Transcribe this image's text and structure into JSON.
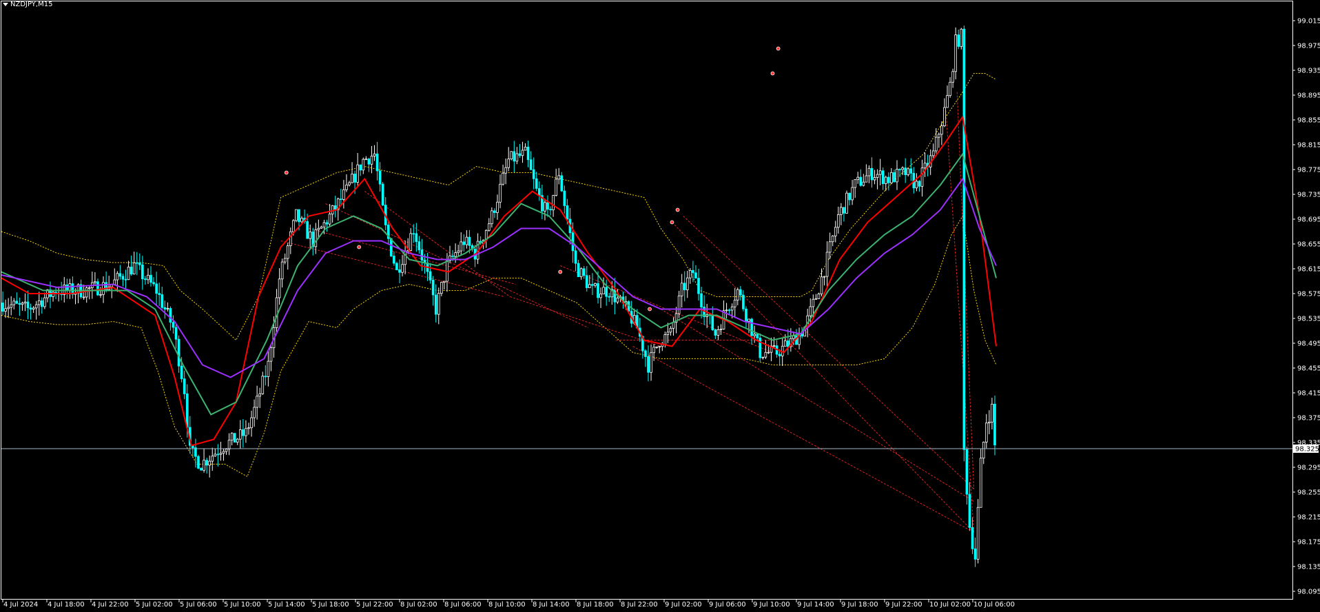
{
  "symbol": {
    "label": "NZDJPY,M15"
  },
  "colors": {
    "background": "#000000",
    "frame": "#ffffff",
    "candle_bull": "#ffffff",
    "candle_bear": "#00ffff",
    "ma_fast": "#ff0000",
    "ma_mid": "#3cb371",
    "ma_slow": "#9b30ff",
    "bands": "#ffd700",
    "fan_lines": "#ff2a2a",
    "price_line": "#a9b7c6"
  },
  "chart_data": {
    "type": "candlestick",
    "timeframe": "M15",
    "symbol": "NZDJPY",
    "ylim": [
      98.095,
      99.015
    ],
    "y_ticks": [
      "99.015",
      "98.975",
      "98.935",
      "98.895",
      "98.855",
      "98.815",
      "98.775",
      "98.735",
      "98.695",
      "98.655",
      "98.615",
      "98.575",
      "98.535",
      "98.495",
      "98.455",
      "98.415",
      "98.375",
      "98.335",
      "98.295",
      "98.255",
      "98.215",
      "98.175",
      "98.135",
      "98.095"
    ],
    "x_ticks": [
      "4 Jul 2024",
      "4 Jul 18:00",
      "4 Jul 22:00",
      "5 Jul 02:00",
      "5 Jul 06:00",
      "5 Jul 10:00",
      "5 Jul 14:00",
      "5 Jul 18:00",
      "5 Jul 22:00",
      "8 Jul 02:00",
      "8 Jul 06:00",
      "8 Jul 10:00",
      "8 Jul 14:00",
      "8 Jul 18:00",
      "8 Jul 22:00",
      "9 Jul 02:00",
      "9 Jul 06:00",
      "9 Jul 10:00",
      "9 Jul 14:00",
      "9 Jul 18:00",
      "9 Jul 22:00",
      "10 Jul 02:00",
      "10 Jul 06:00"
    ],
    "current_price": "98.325",
    "price_path": [
      [
        0,
        98.56
      ],
      [
        10,
        98.55
      ],
      [
        20,
        98.58
      ],
      [
        30,
        98.58
      ],
      [
        40,
        98.59
      ],
      [
        48,
        98.62
      ],
      [
        56,
        98.58
      ],
      [
        62,
        98.52
      ],
      [
        66,
        98.42
      ],
      [
        68,
        98.32
      ],
      [
        72,
        98.3
      ],
      [
        80,
        98.33
      ],
      [
        88,
        98.35
      ],
      [
        92,
        98.4
      ],
      [
        96,
        98.46
      ],
      [
        100,
        98.6
      ],
      [
        106,
        98.7
      ],
      [
        112,
        98.66
      ],
      [
        118,
        98.7
      ],
      [
        124,
        98.74
      ],
      [
        130,
        98.79
      ],
      [
        134,
        98.8
      ],
      [
        138,
        98.68
      ],
      [
        142,
        98.61
      ],
      [
        148,
        98.68
      ],
      [
        152,
        98.62
      ],
      [
        156,
        98.55
      ],
      [
        160,
        98.62
      ],
      [
        166,
        98.66
      ],
      [
        170,
        98.64
      ],
      [
        176,
        98.7
      ],
      [
        182,
        98.79
      ],
      [
        188,
        98.8
      ],
      [
        192,
        98.74
      ],
      [
        196,
        98.7
      ],
      [
        200,
        98.77
      ],
      [
        206,
        98.62
      ],
      [
        212,
        98.58
      ],
      [
        218,
        98.58
      ],
      [
        224,
        98.55
      ],
      [
        228,
        98.52
      ],
      [
        232,
        98.46
      ],
      [
        236,
        98.5
      ],
      [
        240,
        98.51
      ],
      [
        244,
        98.58
      ],
      [
        248,
        98.61
      ],
      [
        252,
        98.55
      ],
      [
        256,
        98.51
      ],
      [
        260,
        98.55
      ],
      [
        264,
        98.58
      ],
      [
        268,
        98.53
      ],
      [
        272,
        98.48
      ],
      [
        278,
        98.48
      ],
      [
        284,
        98.5
      ],
      [
        288,
        98.52
      ],
      [
        292,
        98.57
      ],
      [
        296,
        98.63
      ],
      [
        300,
        98.7
      ],
      [
        306,
        98.75
      ],
      [
        312,
        98.77
      ],
      [
        318,
        98.76
      ],
      [
        324,
        98.77
      ],
      [
        328,
        98.75
      ],
      [
        334,
        98.8
      ],
      [
        338,
        98.87
      ],
      [
        340,
        98.91
      ],
      [
        342,
        98.98
      ],
      [
        344,
        98.99
      ],
      [
        345,
        98.32
      ],
      [
        347,
        98.2
      ],
      [
        349,
        98.15
      ],
      [
        351,
        98.3
      ],
      [
        353,
        98.37
      ],
      [
        355,
        98.39
      ],
      [
        356,
        98.33
      ]
    ],
    "candle_count": 356,
    "series": [
      {
        "name": "ma_fast",
        "style": "solid",
        "color": "#ff0000",
        "values": [
          [
            0,
            98.6
          ],
          [
            10,
            98.575
          ],
          [
            25,
            98.575
          ],
          [
            40,
            98.585
          ],
          [
            55,
            98.54
          ],
          [
            62,
            98.44
          ],
          [
            68,
            98.33
          ],
          [
            76,
            98.34
          ],
          [
            84,
            98.4
          ],
          [
            92,
            98.57
          ],
          [
            100,
            98.65
          ],
          [
            110,
            98.7
          ],
          [
            120,
            98.71
          ],
          [
            130,
            98.76
          ],
          [
            140,
            98.68
          ],
          [
            150,
            98.62
          ],
          [
            160,
            98.61
          ],
          [
            170,
            98.64
          ],
          [
            180,
            98.7
          ],
          [
            190,
            98.74
          ],
          [
            200,
            98.71
          ],
          [
            210,
            98.64
          ],
          [
            220,
            98.58
          ],
          [
            230,
            98.5
          ],
          [
            240,
            98.49
          ],
          [
            250,
            98.55
          ],
          [
            260,
            98.53
          ],
          [
            270,
            98.5
          ],
          [
            280,
            98.48
          ],
          [
            290,
            98.53
          ],
          [
            300,
            98.63
          ],
          [
            310,
            98.69
          ],
          [
            320,
            98.73
          ],
          [
            330,
            98.77
          ],
          [
            338,
            98.82
          ],
          [
            344,
            98.86
          ],
          [
            350,
            98.7
          ],
          [
            356,
            98.49
          ]
        ]
      },
      {
        "name": "ma_mid",
        "style": "solid",
        "color": "#3cb371",
        "values": [
          [
            0,
            98.61
          ],
          [
            15,
            98.58
          ],
          [
            30,
            98.58
          ],
          [
            45,
            98.58
          ],
          [
            55,
            98.55
          ],
          [
            65,
            98.46
          ],
          [
            75,
            98.38
          ],
          [
            84,
            98.4
          ],
          [
            95,
            98.5
          ],
          [
            106,
            98.62
          ],
          [
            116,
            98.68
          ],
          [
            126,
            98.7
          ],
          [
            136,
            98.68
          ],
          [
            146,
            98.63
          ],
          [
            156,
            98.62
          ],
          [
            166,
            98.64
          ],
          [
            176,
            98.67
          ],
          [
            186,
            98.72
          ],
          [
            196,
            98.7
          ],
          [
            206,
            98.65
          ],
          [
            216,
            98.59
          ],
          [
            226,
            98.55
          ],
          [
            236,
            98.52
          ],
          [
            246,
            98.54
          ],
          [
            256,
            98.54
          ],
          [
            266,
            98.52
          ],
          [
            276,
            98.5
          ],
          [
            286,
            98.51
          ],
          [
            296,
            98.58
          ],
          [
            306,
            98.63
          ],
          [
            316,
            98.67
          ],
          [
            326,
            98.7
          ],
          [
            336,
            98.75
          ],
          [
            344,
            98.8
          ],
          [
            350,
            98.7
          ],
          [
            356,
            98.6
          ]
        ]
      },
      {
        "name": "ma_slow",
        "style": "solid",
        "color": "#9b30ff",
        "values": [
          [
            0,
            98.605
          ],
          [
            20,
            98.585
          ],
          [
            40,
            98.59
          ],
          [
            52,
            98.57
          ],
          [
            62,
            98.53
          ],
          [
            72,
            98.46
          ],
          [
            82,
            98.44
          ],
          [
            94,
            98.47
          ],
          [
            106,
            98.58
          ],
          [
            116,
            98.64
          ],
          [
            126,
            98.66
          ],
          [
            136,
            98.66
          ],
          [
            146,
            98.64
          ],
          [
            156,
            98.63
          ],
          [
            166,
            98.63
          ],
          [
            176,
            98.65
          ],
          [
            186,
            98.68
          ],
          [
            196,
            98.68
          ],
          [
            206,
            98.65
          ],
          [
            216,
            98.61
          ],
          [
            226,
            98.57
          ],
          [
            236,
            98.55
          ],
          [
            246,
            98.55
          ],
          [
            256,
            98.55
          ],
          [
            266,
            98.53
          ],
          [
            276,
            98.52
          ],
          [
            286,
            98.51
          ],
          [
            296,
            98.55
          ],
          [
            306,
            98.6
          ],
          [
            316,
            98.64
          ],
          [
            326,
            98.67
          ],
          [
            336,
            98.71
          ],
          [
            344,
            98.76
          ],
          [
            350,
            98.68
          ],
          [
            356,
            98.62
          ]
        ]
      },
      {
        "name": "band_upper",
        "style": "dotted",
        "color": "#ffd700",
        "values": [
          [
            0,
            98.675
          ],
          [
            10,
            98.66
          ],
          [
            20,
            98.64
          ],
          [
            30,
            98.63
          ],
          [
            40,
            98.625
          ],
          [
            50,
            98.625
          ],
          [
            58,
            98.62
          ],
          [
            64,
            98.58
          ],
          [
            72,
            98.55
          ],
          [
            84,
            98.5
          ],
          [
            92,
            98.57
          ],
          [
            100,
            98.73
          ],
          [
            110,
            98.75
          ],
          [
            120,
            98.77
          ],
          [
            130,
            98.78
          ],
          [
            140,
            98.77
          ],
          [
            150,
            98.76
          ],
          [
            160,
            98.75
          ],
          [
            170,
            98.78
          ],
          [
            180,
            98.77
          ],
          [
            190,
            98.77
          ],
          [
            200,
            98.76
          ],
          [
            210,
            98.75
          ],
          [
            220,
            98.74
          ],
          [
            230,
            98.73
          ],
          [
            236,
            98.68
          ],
          [
            244,
            98.63
          ],
          [
            250,
            98.58
          ],
          [
            256,
            98.57
          ],
          [
            266,
            98.57
          ],
          [
            276,
            98.57
          ],
          [
            286,
            98.57
          ],
          [
            290,
            98.58
          ],
          [
            296,
            98.63
          ],
          [
            304,
            98.68
          ],
          [
            312,
            98.72
          ],
          [
            320,
            98.76
          ],
          [
            330,
            98.8
          ],
          [
            338,
            98.86
          ],
          [
            344,
            98.9
          ],
          [
            348,
            98.93
          ],
          [
            352,
            98.93
          ],
          [
            356,
            98.92
          ]
        ]
      },
      {
        "name": "band_lower",
        "style": "dotted",
        "color": "#ffd700",
        "values": [
          [
            0,
            98.54
          ],
          [
            10,
            98.53
          ],
          [
            20,
            98.525
          ],
          [
            30,
            98.525
          ],
          [
            40,
            98.53
          ],
          [
            50,
            98.52
          ],
          [
            56,
            98.45
          ],
          [
            62,
            98.36
          ],
          [
            70,
            98.3
          ],
          [
            80,
            98.3
          ],
          [
            88,
            98.28
          ],
          [
            94,
            98.35
          ],
          [
            100,
            98.45
          ],
          [
            110,
            98.53
          ],
          [
            120,
            98.52
          ],
          [
            126,
            98.55
          ],
          [
            136,
            98.58
          ],
          [
            146,
            98.59
          ],
          [
            156,
            98.58
          ],
          [
            166,
            98.58
          ],
          [
            176,
            98.6
          ],
          [
            186,
            98.6
          ],
          [
            196,
            98.58
          ],
          [
            206,
            98.56
          ],
          [
            216,
            98.52
          ],
          [
            226,
            98.48
          ],
          [
            236,
            98.47
          ],
          [
            246,
            98.47
          ],
          [
            256,
            98.47
          ],
          [
            266,
            98.47
          ],
          [
            276,
            98.46
          ],
          [
            286,
            98.46
          ],
          [
            296,
            98.46
          ],
          [
            306,
            98.46
          ],
          [
            316,
            98.47
          ],
          [
            326,
            98.52
          ],
          [
            334,
            98.59
          ],
          [
            340,
            98.67
          ],
          [
            344,
            98.7
          ],
          [
            348,
            98.58
          ],
          [
            352,
            98.5
          ],
          [
            356,
            98.46
          ]
        ]
      }
    ],
    "fan_lines": [
      [
        [
          116,
          98.72
        ],
        [
          182,
          98.58
        ]
      ],
      [
        [
          130,
          98.74
        ],
        [
          182,
          98.57
        ]
      ],
      [
        [
          100,
          98.66
        ],
        [
          180,
          98.57
        ]
      ],
      [
        [
          110,
          98.68
        ],
        [
          184,
          98.59
        ]
      ],
      [
        [
          182,
          98.58
        ],
        [
          210,
          98.52
        ]
      ],
      [
        [
          182,
          98.57
        ],
        [
          236,
          98.49
        ]
      ],
      [
        [
          200,
          98.62
        ],
        [
          276,
          98.48
        ]
      ],
      [
        [
          220,
          98.5
        ],
        [
          276,
          98.5
        ]
      ],
      [
        [
          226,
          98.49
        ],
        [
          348,
          98.19
        ]
      ],
      [
        [
          240,
          98.69
        ],
        [
          348,
          98.19
        ]
      ],
      [
        [
          236,
          98.55
        ],
        [
          348,
          98.24
        ]
      ],
      [
        [
          244,
          98.7
        ],
        [
          348,
          98.26
        ]
      ],
      [
        [
          338,
          98.87
        ],
        [
          348,
          98.19
        ]
      ],
      [
        [
          342,
          98.9
        ],
        [
          348,
          98.26
        ]
      ]
    ],
    "fractal_markers": [
      [
        102,
        98.77
      ],
      [
        128,
        98.65
      ],
      [
        200,
        98.61
      ],
      [
        232,
        98.55
      ],
      [
        240,
        98.69
      ],
      [
        242,
        98.71
      ],
      [
        276,
        98.93
      ],
      [
        278,
        98.97
      ]
    ]
  }
}
